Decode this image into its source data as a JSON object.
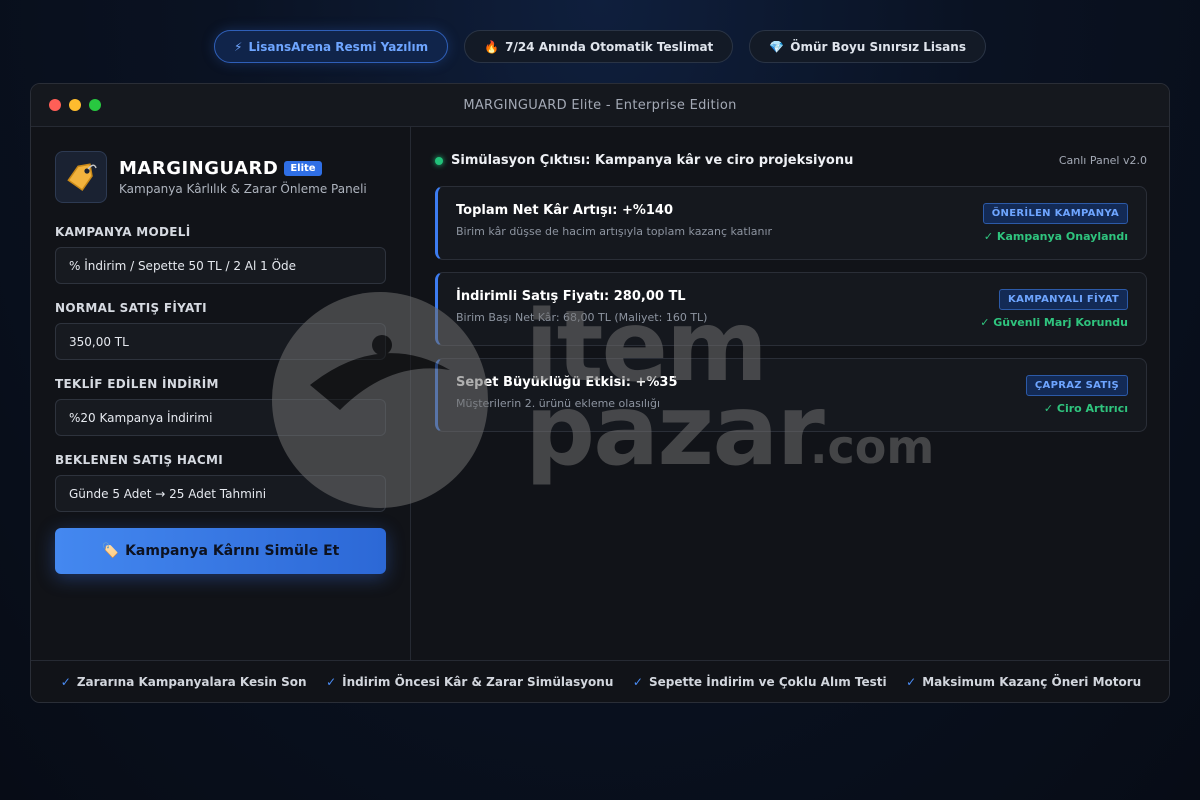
{
  "top_pills": [
    {
      "icon": "⚡",
      "label": "LisansArena Resmi Yazılım"
    },
    {
      "icon": "🔥",
      "label": "7/24 Anında Otomatik Teslimat"
    },
    {
      "icon": "💎",
      "label": "Ömür Boyu Sınırsız Lisans"
    }
  ],
  "window": {
    "title": "MARGINGUARD Elite - Enterprise Edition"
  },
  "brand": {
    "name": "MARGINGUARD",
    "badge": "Elite",
    "subtitle": "Kampanya Kârlılık & Zarar Önleme Paneli",
    "logo_icon": "price-tag-icon"
  },
  "form": {
    "fields": [
      {
        "label": "KAMPANYA MODELİ",
        "value": "% İndirim / Sepette 50 TL / 2 Al 1 Öde"
      },
      {
        "label": "NORMAL SATIŞ FİYATI",
        "value": "350,00 TL"
      },
      {
        "label": "TEKLİF EDİLEN İNDİRİM",
        "value": "%20 Kampanya İndirimi"
      },
      {
        "label": "BEKLENEN SATIŞ HACMI",
        "value": "Günde 5 Adet → 25 Adet Tahmini"
      }
    ],
    "cta_icon": "🏷️",
    "cta_label": "Kampanya Kârını Simüle Et"
  },
  "output": {
    "title": "Simülasyon Çıktısı: Kampanya kâr ve ciro projeksiyonu",
    "version": "Canlı Panel v2.0",
    "cards": [
      {
        "title": "Toplam Net Kâr Artışı: +%140",
        "sub": "Birim kâr düşse de hacim artışıyla toplam kazanç katlanır",
        "tag": "ÖNERİLEN KAMPANYA",
        "status": "✓ Kampanya Onaylandı"
      },
      {
        "title": "İndirimli Satış Fiyatı: 280,00 TL",
        "sub": "Birim Başı Net Kâr: 68,00 TL (Maliyet: 160 TL)",
        "tag": "KAMPANYALI FİYAT",
        "status": "✓ Güvenli Marj Korundu"
      },
      {
        "title": "Sepet Büyüklüğü Etkisi: +%35",
        "sub": "Müşterilerin 2. ürünü ekleme olasılığı",
        "tag": "ÇAPRAZ SATIŞ",
        "status": "✓ Ciro Artırıcı"
      }
    ]
  },
  "footer": {
    "items": [
      "Zararına Kampanyalara Kesin Son",
      "İndirim Öncesi Kâr & Zarar Simülasyonu",
      "Sepette İndirim ve Çoklu Alım Testi",
      "Maksimum Kazanç Öneri Motoru"
    ],
    "check": "✓"
  },
  "watermark": {
    "line1": "item",
    "line2": "pazar",
    "suffix": ".com"
  },
  "colors": {
    "accent": "#3d7cf0",
    "success": "#2fc47e",
    "background": "#0a1222"
  }
}
